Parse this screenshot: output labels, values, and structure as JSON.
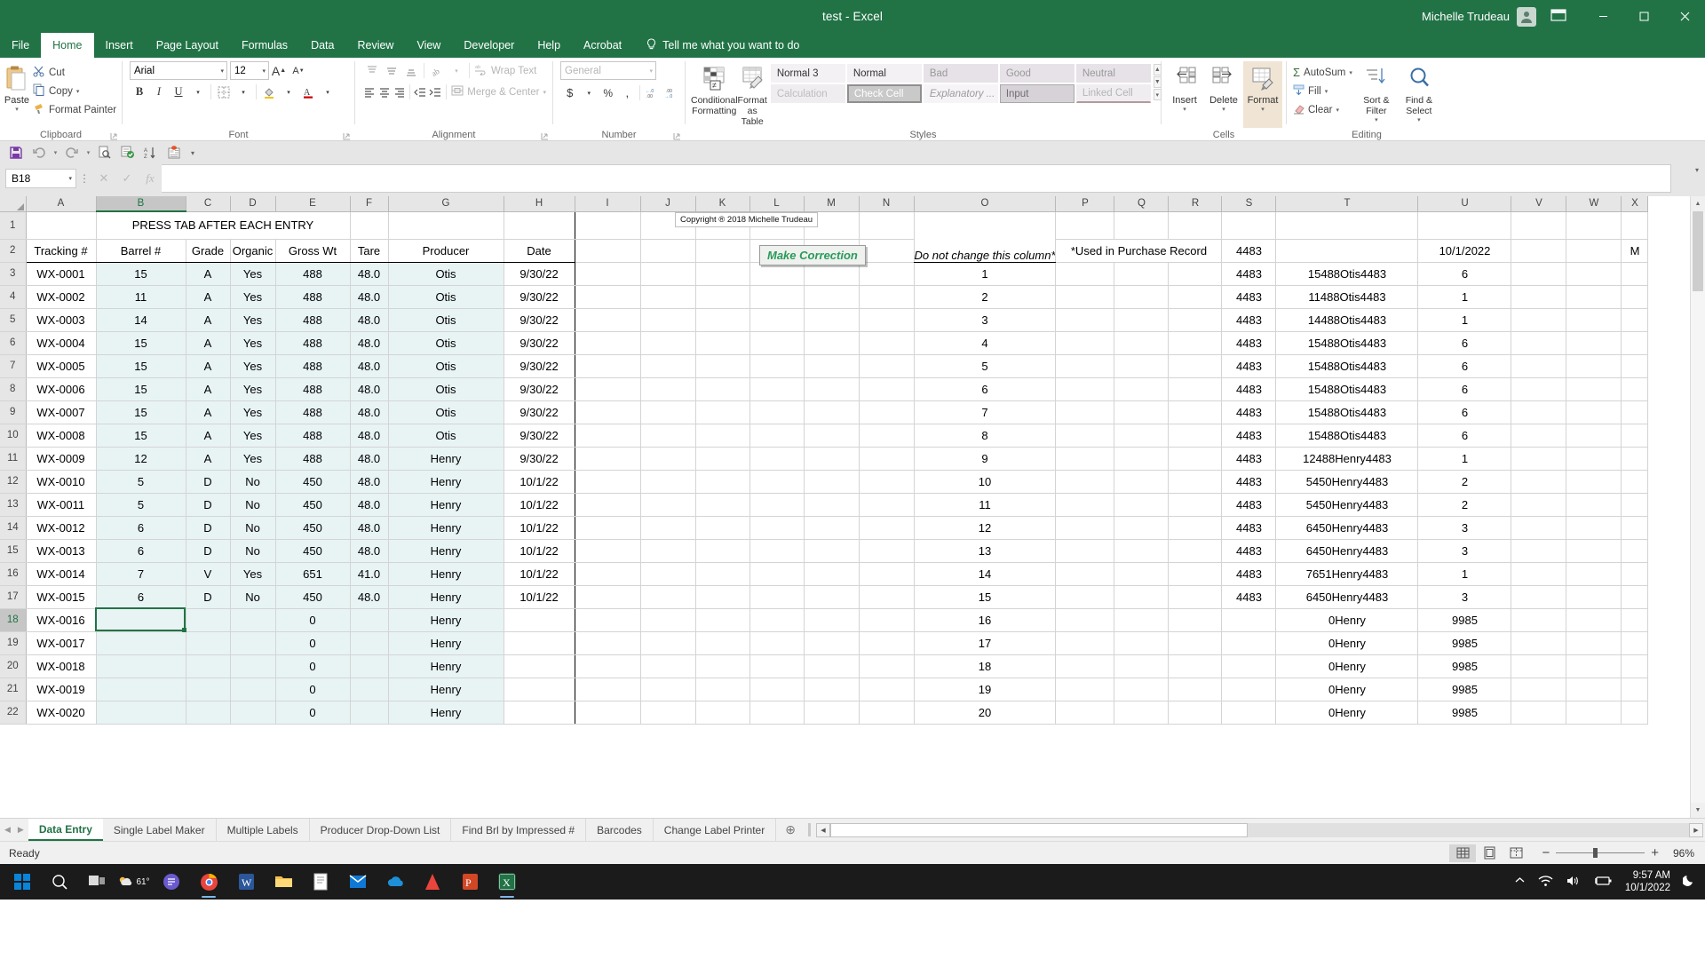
{
  "window": {
    "title": "test  -  Excel",
    "user": "Michelle Trudeau",
    "minimize": "–",
    "maximize": "□",
    "close": "✕"
  },
  "ribbon_tabs": [
    {
      "label": "File",
      "id": "file"
    },
    {
      "label": "Home",
      "id": "home"
    },
    {
      "label": "Insert",
      "id": "insert"
    },
    {
      "label": "Page Layout",
      "id": "page-layout"
    },
    {
      "label": "Formulas",
      "id": "formulas"
    },
    {
      "label": "Data",
      "id": "data"
    },
    {
      "label": "Review",
      "id": "review"
    },
    {
      "label": "View",
      "id": "view"
    },
    {
      "label": "Developer",
      "id": "developer"
    },
    {
      "label": "Help",
      "id": "help"
    },
    {
      "label": "Acrobat",
      "id": "acrobat"
    }
  ],
  "tell_me": "Tell me what you want to do",
  "groups": {
    "clipboard": {
      "label": "Clipboard",
      "paste": "Paste",
      "cut": "Cut",
      "copy": "Copy",
      "format_painter": "Format Painter"
    },
    "font": {
      "label": "Font",
      "font_name": "Arial",
      "font_size": "12",
      "grow": "A",
      "shrink": "A",
      "bold": "B",
      "italic": "I",
      "underline": "U"
    },
    "alignment": {
      "label": "Alignment",
      "wrap_text": "Wrap Text",
      "merge_center": "Merge & Center"
    },
    "number": {
      "label": "Number",
      "format": "General",
      "currency": "$",
      "percent": "%",
      "comma": ","
    },
    "styles": {
      "label": "Styles",
      "conditional_formatting": "Conditional Formatting",
      "format_as_table": "Format as Table",
      "cells": [
        {
          "label": "Normal 3",
          "kind": "norm"
        },
        {
          "label": "Normal",
          "kind": "norm"
        },
        {
          "label": "Bad",
          "kind": "gray"
        },
        {
          "label": "Good",
          "kind": "gray"
        },
        {
          "label": "Neutral",
          "kind": "gray"
        },
        {
          "label": "Calculation",
          "kind": "calc"
        },
        {
          "label": "Check Cell",
          "kind": "check"
        },
        {
          "label": "Explanatory ...",
          "kind": "expl"
        },
        {
          "label": "Input",
          "kind": "input"
        },
        {
          "label": "Linked Cell",
          "kind": "linked"
        }
      ]
    },
    "cells": {
      "label": "Cells",
      "insert": "Insert",
      "delete": "Delete",
      "format": "Format"
    },
    "editing": {
      "label": "Editing",
      "autosum": "AutoSum",
      "fill": "Fill",
      "clear": "Clear",
      "sort_filter": "Sort & Filter",
      "find_select": "Find & Select"
    }
  },
  "formula_bar": {
    "name_box": "B18",
    "formula": ""
  },
  "grid": {
    "columns": [
      "A",
      "B",
      "C",
      "D",
      "E",
      "F",
      "G",
      "H",
      "I",
      "J",
      "K",
      "L",
      "M",
      "N",
      "O",
      "P",
      "Q",
      "R",
      "S",
      "T",
      "U",
      "V",
      "W",
      "X"
    ],
    "selected_column": "B",
    "selected_row": "18",
    "banner": "PRESS TAB AFTER EACH ENTRY",
    "copyright": "Copyright ® 2018 Michelle Trudeau",
    "make_correction_button": "Make Correction",
    "do_not_change": "Do not change this column*",
    "used_in_purchase_record": "*Used in Purchase Record",
    "s2": "4483",
    "u2": "10/1/2022",
    "x2": "M",
    "headers": [
      "Tracking #",
      "Barrel #",
      "Grade",
      "Organic",
      "Gross Wt",
      "Tare",
      "Producer",
      "Date"
    ],
    "rows": [
      {
        "r": "3",
        "a": "WX-0001",
        "b": "15",
        "c": "A",
        "d": "Yes",
        "e": "488",
        "f": "48.0",
        "g": "Otis",
        "h": "9/30/22",
        "o": "1",
        "s": "4483",
        "t": "15488Otis4483",
        "u": "6"
      },
      {
        "r": "4",
        "a": "WX-0002",
        "b": "11",
        "c": "A",
        "d": "Yes",
        "e": "488",
        "f": "48.0",
        "g": "Otis",
        "h": "9/30/22",
        "o": "2",
        "s": "4483",
        "t": "11488Otis4483",
        "u": "1"
      },
      {
        "r": "5",
        "a": "WX-0003",
        "b": "14",
        "c": "A",
        "d": "Yes",
        "e": "488",
        "f": "48.0",
        "g": "Otis",
        "h": "9/30/22",
        "o": "3",
        "s": "4483",
        "t": "14488Otis4483",
        "u": "1"
      },
      {
        "r": "6",
        "a": "WX-0004",
        "b": "15",
        "c": "A",
        "d": "Yes",
        "e": "488",
        "f": "48.0",
        "g": "Otis",
        "h": "9/30/22",
        "o": "4",
        "s": "4483",
        "t": "15488Otis4483",
        "u": "6"
      },
      {
        "r": "7",
        "a": "WX-0005",
        "b": "15",
        "c": "A",
        "d": "Yes",
        "e": "488",
        "f": "48.0",
        "g": "Otis",
        "h": "9/30/22",
        "o": "5",
        "s": "4483",
        "t": "15488Otis4483",
        "u": "6"
      },
      {
        "r": "8",
        "a": "WX-0006",
        "b": "15",
        "c": "A",
        "d": "Yes",
        "e": "488",
        "f": "48.0",
        "g": "Otis",
        "h": "9/30/22",
        "o": "6",
        "s": "4483",
        "t": "15488Otis4483",
        "u": "6"
      },
      {
        "r": "9",
        "a": "WX-0007",
        "b": "15",
        "c": "A",
        "d": "Yes",
        "e": "488",
        "f": "48.0",
        "g": "Otis",
        "h": "9/30/22",
        "o": "7",
        "s": "4483",
        "t": "15488Otis4483",
        "u": "6"
      },
      {
        "r": "10",
        "a": "WX-0008",
        "b": "15",
        "c": "A",
        "d": "Yes",
        "e": "488",
        "f": "48.0",
        "g": "Otis",
        "h": "9/30/22",
        "o": "8",
        "s": "4483",
        "t": "15488Otis4483",
        "u": "6"
      },
      {
        "r": "11",
        "a": "WX-0009",
        "b": "12",
        "c": "A",
        "d": "Yes",
        "e": "488",
        "f": "48.0",
        "g": "Henry",
        "h": "9/30/22",
        "o": "9",
        "s": "4483",
        "t": "12488Henry4483",
        "u": "1"
      },
      {
        "r": "12",
        "a": "WX-0010",
        "b": "5",
        "c": "D",
        "d": "No",
        "e": "450",
        "f": "48.0",
        "g": "Henry",
        "h": "10/1/22",
        "o": "10",
        "s": "4483",
        "t": "5450Henry4483",
        "u": "2"
      },
      {
        "r": "13",
        "a": "WX-0011",
        "b": "5",
        "c": "D",
        "d": "No",
        "e": "450",
        "f": "48.0",
        "g": "Henry",
        "h": "10/1/22",
        "o": "11",
        "s": "4483",
        "t": "5450Henry4483",
        "u": "2"
      },
      {
        "r": "14",
        "a": "WX-0012",
        "b": "6",
        "c": "D",
        "d": "No",
        "e": "450",
        "f": "48.0",
        "g": "Henry",
        "h": "10/1/22",
        "o": "12",
        "s": "4483",
        "t": "6450Henry4483",
        "u": "3"
      },
      {
        "r": "15",
        "a": "WX-0013",
        "b": "6",
        "c": "D",
        "d": "No",
        "e": "450",
        "f": "48.0",
        "g": "Henry",
        "h": "10/1/22",
        "o": "13",
        "s": "4483",
        "t": "6450Henry4483",
        "u": "3"
      },
      {
        "r": "16",
        "a": "WX-0014",
        "b": "7",
        "c": "V",
        "d": "Yes",
        "e": "651",
        "f": "41.0",
        "g": "Henry",
        "h": "10/1/22",
        "o": "14",
        "s": "4483",
        "t": "7651Henry4483",
        "u": "1"
      },
      {
        "r": "17",
        "a": "WX-0015",
        "b": "6",
        "c": "D",
        "d": "No",
        "e": "450",
        "f": "48.0",
        "g": "Henry",
        "h": "10/1/22",
        "o": "15",
        "s": "4483",
        "t": "6450Henry4483",
        "u": "3"
      },
      {
        "r": "18",
        "a": "WX-0016",
        "b": "",
        "c": "",
        "d": "",
        "e": "0",
        "f": "",
        "g": "Henry",
        "h": "",
        "o": "16",
        "s": "",
        "t": "0Henry",
        "u": "9985"
      },
      {
        "r": "19",
        "a": "WX-0017",
        "b": "",
        "c": "",
        "d": "",
        "e": "0",
        "f": "",
        "g": "Henry",
        "h": "",
        "o": "17",
        "s": "",
        "t": "0Henry",
        "u": "9985"
      },
      {
        "r": "20",
        "a": "WX-0018",
        "b": "",
        "c": "",
        "d": "",
        "e": "0",
        "f": "",
        "g": "Henry",
        "h": "",
        "o": "18",
        "s": "",
        "t": "0Henry",
        "u": "9985"
      },
      {
        "r": "21",
        "a": "WX-0019",
        "b": "",
        "c": "",
        "d": "",
        "e": "0",
        "f": "",
        "g": "Henry",
        "h": "",
        "o": "19",
        "s": "",
        "t": "0Henry",
        "u": "9985"
      },
      {
        "r": "22",
        "a": "WX-0020",
        "b": "",
        "c": "",
        "d": "",
        "e": "0",
        "f": "",
        "g": "Henry",
        "h": "",
        "o": "20",
        "s": "",
        "t": "0Henry",
        "u": "9985"
      }
    ]
  },
  "sheet_tabs": [
    {
      "label": "Data Entry",
      "active": true
    },
    {
      "label": "Single Label Maker",
      "active": false
    },
    {
      "label": "Multiple Labels",
      "active": false
    },
    {
      "label": "Producer Drop-Down List",
      "active": false
    },
    {
      "label": "Find Brl by Impressed #",
      "active": false
    },
    {
      "label": "Barcodes",
      "active": false
    },
    {
      "label": "Change Label Printer",
      "active": false
    }
  ],
  "status": {
    "ready": "Ready",
    "zoom": "96%"
  },
  "taskbar": {
    "weather_temp": "61°",
    "time": "9:57 AM",
    "date": "10/1/2022"
  },
  "colors": {
    "excel_green": "#217346",
    "banner_blue": "#1f7fd0",
    "tint": "#e8f4f4",
    "button_green": "#2a9a5b"
  }
}
